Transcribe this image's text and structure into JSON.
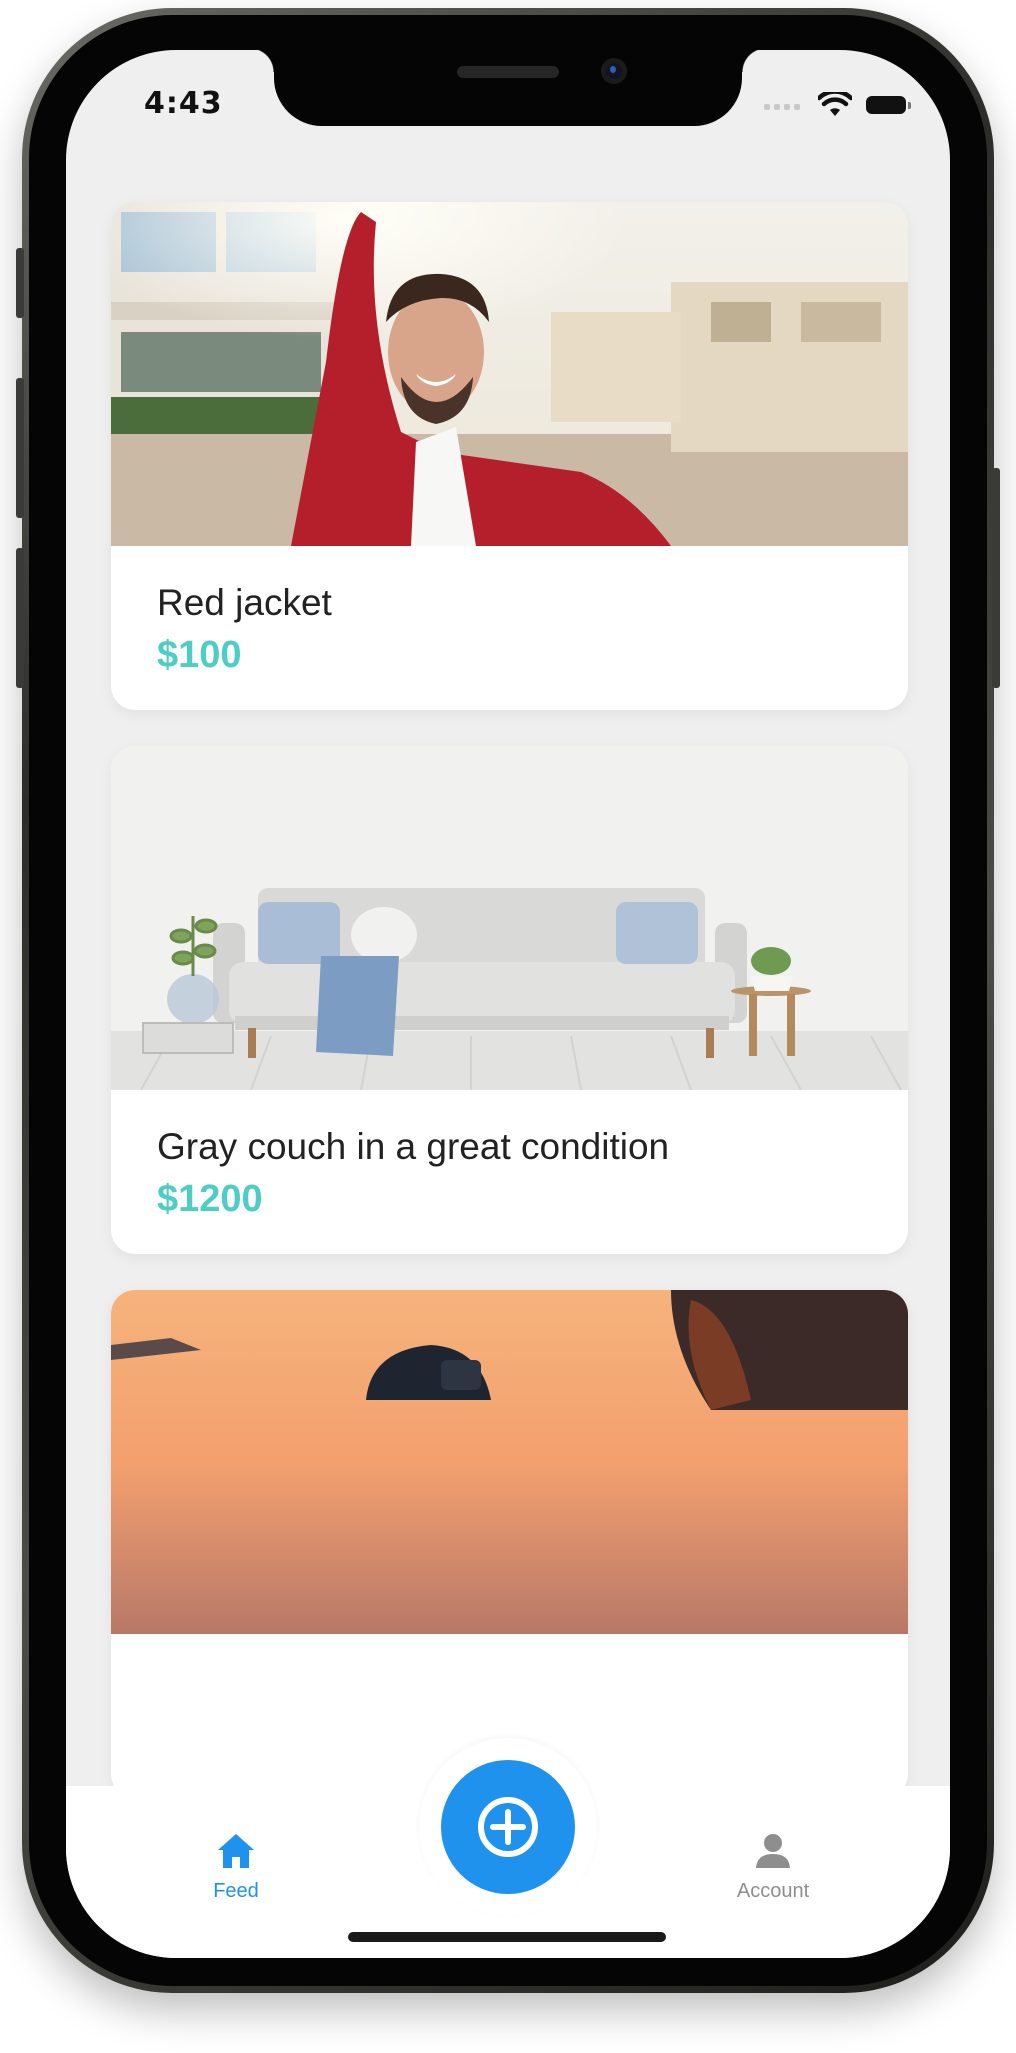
{
  "status_bar": {
    "time": "4:43"
  },
  "feed": {
    "listings": [
      {
        "title": "Red jacket",
        "price": "$100"
      },
      {
        "title": "Gray couch in a great condition",
        "price": "$1200"
      },
      {
        "title": "",
        "price": ""
      }
    ]
  },
  "tab_bar": {
    "feed_label": "Feed",
    "account_label": "Account",
    "active_color": "#1f92ee",
    "inactive_color": "#8e8e8e"
  },
  "colors": {
    "price": "#4ecdc4",
    "background": "#efefef",
    "accent": "#1f92ee"
  },
  "icons": [
    "home-icon",
    "plus-icon",
    "user-icon",
    "wifi-icon",
    "battery-icon"
  ]
}
